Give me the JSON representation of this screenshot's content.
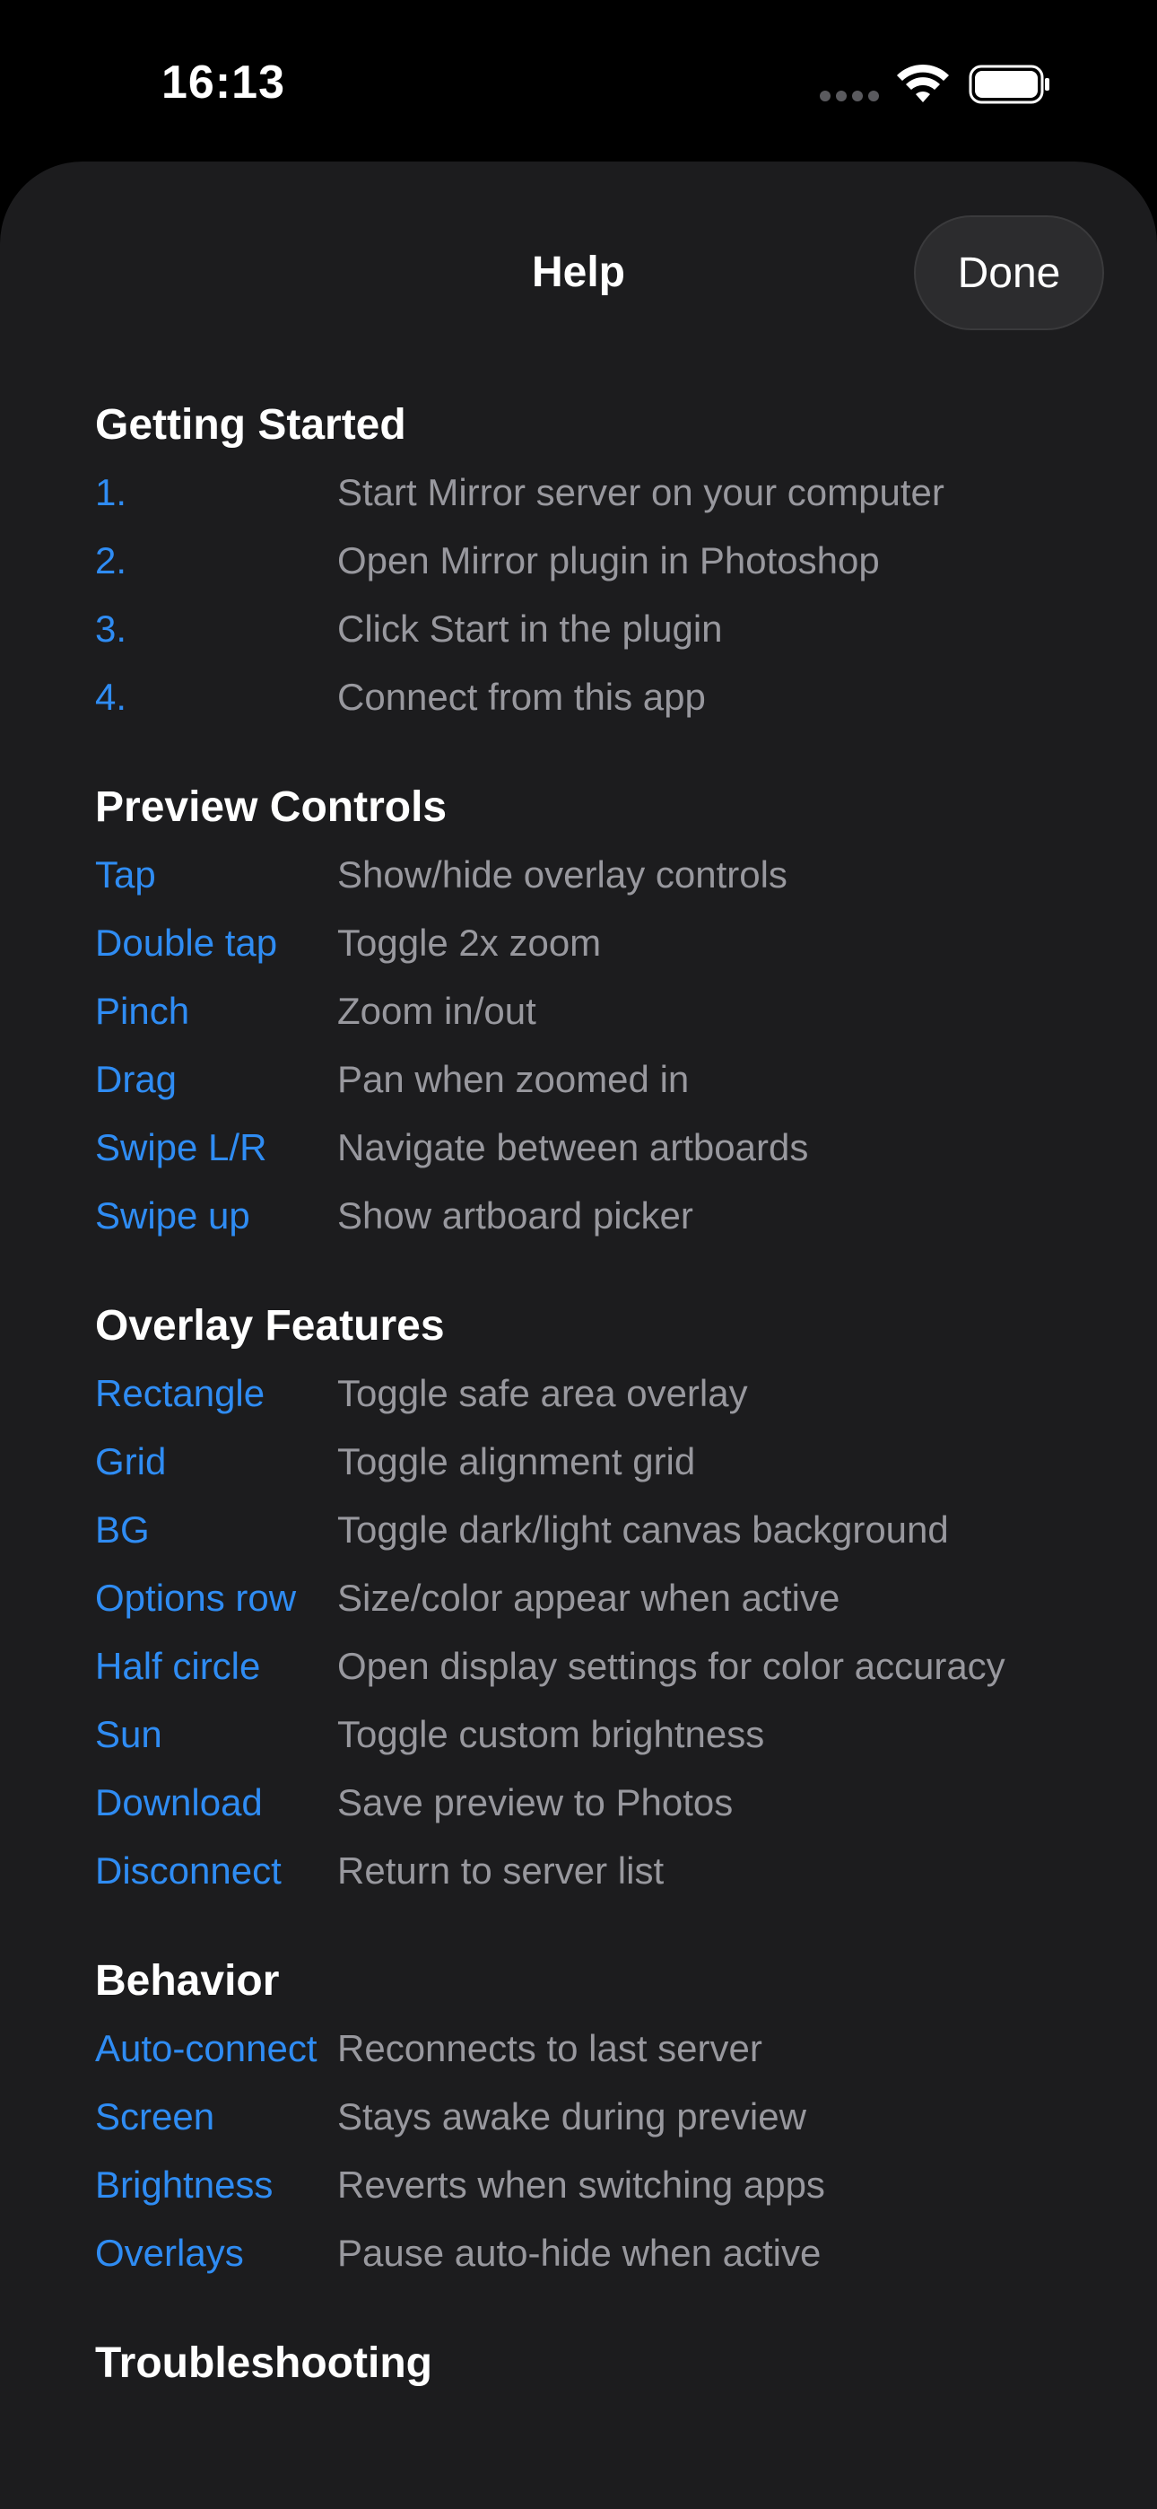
{
  "status_bar": {
    "time": "16:13",
    "icons": [
      "signal-dots-icon",
      "wifi-icon",
      "battery-icon"
    ]
  },
  "header": {
    "title": "Help",
    "done_label": "Done"
  },
  "colors": {
    "background": "#1c1c1e",
    "accent": "#2f8cf3",
    "secondary_text": "#98989e",
    "primary_text": "#ffffff"
  },
  "sections": [
    {
      "title": "Getting Started",
      "rows": [
        {
          "key": "1.",
          "value": "Start Mirror server on your computer"
        },
        {
          "key": "2.",
          "value": "Open Mirror plugin in Photoshop"
        },
        {
          "key": "3.",
          "value": "Click Start in the plugin"
        },
        {
          "key": "4.",
          "value": "Connect from this app"
        }
      ]
    },
    {
      "title": "Preview Controls",
      "rows": [
        {
          "key": "Tap",
          "value": "Show/hide overlay controls"
        },
        {
          "key": "Double tap",
          "value": "Toggle 2x zoom"
        },
        {
          "key": "Pinch",
          "value": "Zoom in/out"
        },
        {
          "key": "Drag",
          "value": "Pan when zoomed in"
        },
        {
          "key": "Swipe L/R",
          "value": "Navigate between artboards"
        },
        {
          "key": "Swipe up",
          "value": "Show artboard picker"
        }
      ]
    },
    {
      "title": "Overlay Features",
      "rows": [
        {
          "key": "Rectangle",
          "value": "Toggle safe area overlay"
        },
        {
          "key": "Grid",
          "value": "Toggle alignment grid"
        },
        {
          "key": "BG",
          "value": "Toggle dark/light canvas background"
        },
        {
          "key": "Options row",
          "value": "Size/color appear when active"
        },
        {
          "key": "Half circle",
          "value": "Open display settings for color accuracy"
        },
        {
          "key": "Sun",
          "value": "Toggle custom brightness"
        },
        {
          "key": "Download",
          "value": "Save preview to Photos"
        },
        {
          "key": "Disconnect",
          "value": "Return to server list"
        }
      ]
    },
    {
      "title": "Behavior",
      "rows": [
        {
          "key": "Auto-connect",
          "value": "Reconnects to last server"
        },
        {
          "key": "Screen",
          "value": "Stays awake during preview"
        },
        {
          "key": "Brightness",
          "value": "Reverts when switching apps"
        },
        {
          "key": "Overlays",
          "value": "Pause auto-hide when active"
        }
      ]
    },
    {
      "title": "Troubleshooting",
      "rows": []
    }
  ]
}
